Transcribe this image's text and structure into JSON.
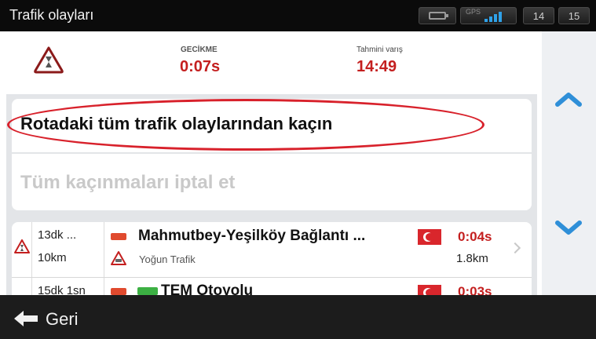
{
  "topbar": {
    "title": "Trafik olayları",
    "gps_label": "GPS",
    "status_1": "14",
    "status_2": "15"
  },
  "info": {
    "delay_label": "GECİKME",
    "delay_value": "0:07s",
    "eta_label": "Tahmini varış",
    "eta_value": "14:49"
  },
  "options": {
    "avoid_all": "Rotadaki tüm trafik olaylarından kaçın",
    "cancel_all": "Tüm kaçınmaları iptal et"
  },
  "incidents": [
    {
      "time": "13dk ...",
      "distance_from": "10km",
      "road": "Mahmutbey-Yeşilköy Bağlantı ...",
      "type": "Yoğun Trafik",
      "delay": "0:04s",
      "length": "1.8km"
    },
    {
      "time": "15dk 1sn",
      "road": "TEM Otoyolu",
      "delay": "0:03s"
    }
  ],
  "bottom": {
    "back_label": "Geri"
  },
  "colors": {
    "accent_red": "#c41f1f",
    "arrow_blue": "#2f8fd8"
  }
}
